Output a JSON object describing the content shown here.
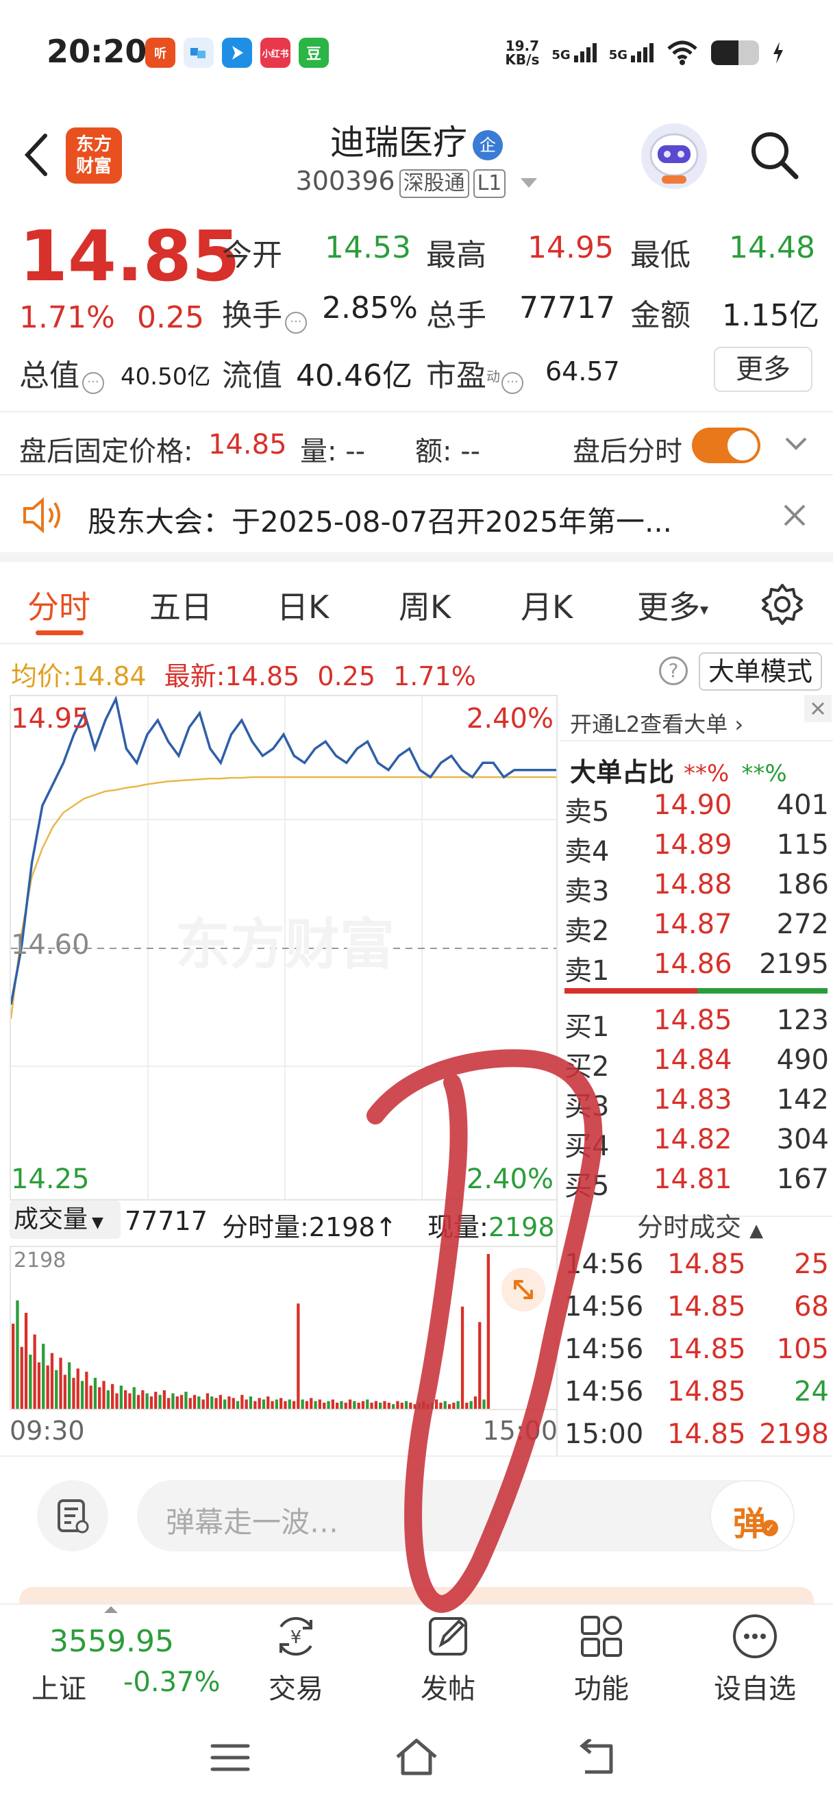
{
  "status_bar": {
    "time": "20:20",
    "app_icons": [
      "听",
      "",
      "",
      "小红书",
      "豆"
    ],
    "net_speed_top": "19.7",
    "net_speed_bottom": "KB/s",
    "sig1": "5G",
    "sig2": "5G"
  },
  "header": {
    "back_icon": "chevron-left-icon",
    "logo_text": "东方财富",
    "stock_name": "迪瑞医疗",
    "badge": "企",
    "code": "300396",
    "tag1": "深股通",
    "tag2": "L1"
  },
  "quote": {
    "price": "14.85",
    "change_pct": "1.71%",
    "change": "0.25",
    "fields": [
      {
        "label": "今开",
        "value": "14.53",
        "color": "green"
      },
      {
        "label": "最高",
        "value": "14.95",
        "color": "red"
      },
      {
        "label": "最低",
        "value": "14.48",
        "color": "green"
      },
      {
        "label": "换手",
        "value": "2.85%",
        "color": "dark"
      },
      {
        "label": "总手",
        "value": "77717",
        "color": "dark"
      },
      {
        "label": "金额",
        "value": "1.15亿",
        "color": "dark"
      },
      {
        "label": "总值",
        "value": "40.50亿",
        "color": "dark"
      },
      {
        "label": "流值",
        "value": "40.46亿",
        "color": "dark"
      },
      {
        "label": "市盈",
        "value": "64.57",
        "color": "dark"
      }
    ],
    "pe_sup": "动",
    "more_label": "更多"
  },
  "after_hours": {
    "label": "盘后固定价格:",
    "price": "14.85",
    "vol_label": "量:",
    "vol_value": "--",
    "amt_label": "额:",
    "amt_value": "--",
    "toggle_label": "盘后分时",
    "toggle_on": true
  },
  "notice": {
    "text": "股东大会：于2025-08-07召开2025年第一..."
  },
  "tabs": [
    "分时",
    "五日",
    "日K",
    "周K",
    "月K",
    "更多"
  ],
  "avg_line": {
    "avg_label": "均价:",
    "avg_value": "14.84",
    "latest_label": "最新:",
    "latest_value": "14.85",
    "change": "0.25",
    "pct": "1.71%",
    "mode_label": "大单模式"
  },
  "chart_data": {
    "type": "line",
    "title": "",
    "y_high_label": "14.95",
    "y_mid_label": "14.60",
    "y_low_label": "14.25",
    "pct_high_label": "2.40%",
    "pct_low_label": "2.40%",
    "ylim": [
      14.25,
      14.95
    ],
    "prev_close": 14.6,
    "price_series": [
      14.52,
      14.6,
      14.72,
      14.8,
      14.83,
      14.86,
      14.9,
      14.93,
      14.88,
      14.92,
      14.95,
      14.88,
      14.86,
      14.9,
      14.92,
      14.89,
      14.87,
      14.91,
      14.93,
      14.88,
      14.86,
      14.9,
      14.92,
      14.89,
      14.87,
      14.88,
      14.9,
      14.87,
      14.86,
      14.88,
      14.89,
      14.87,
      14.86,
      14.88,
      14.89,
      14.86,
      14.85,
      14.87,
      14.88,
      14.85,
      14.84,
      14.86,
      14.87,
      14.85,
      14.84,
      14.86,
      14.86,
      14.84,
      14.85,
      14.85,
      14.85,
      14.85,
      14.85
    ],
    "avg_series": [
      14.5,
      14.62,
      14.7,
      14.74,
      14.77,
      14.79,
      14.8,
      14.81,
      14.815,
      14.82,
      14.822,
      14.825,
      14.827,
      14.83,
      14.832,
      14.834,
      14.835,
      14.836,
      14.837,
      14.838,
      14.838,
      14.839,
      14.839,
      14.84,
      14.84,
      14.84,
      14.84,
      14.84,
      14.84,
      14.84,
      14.84,
      14.84,
      14.84,
      14.84,
      14.84,
      14.84,
      14.84,
      14.84,
      14.84,
      14.84,
      14.84,
      14.84,
      14.84,
      14.84,
      14.84,
      14.84,
      14.84,
      14.84,
      14.84,
      14.84,
      14.84,
      14.84,
      14.84
    ],
    "watermark": "东方财富"
  },
  "volume": {
    "label": "成交量",
    "total": "77717",
    "per_min": "分时量:2198↑",
    "cur_label": "现量:",
    "cur_value": "2198",
    "max_label": "2198",
    "time_start": "09:30",
    "time_end": "15:00",
    "bars": [
      0.55,
      0.7,
      0.4,
      0.62,
      0.35,
      0.48,
      0.3,
      0.42,
      0.28,
      0.36,
      0.25,
      0.33,
      0.22,
      0.3,
      0.2,
      0.26,
      0.18,
      0.24,
      0.15,
      0.2,
      0.14,
      0.18,
      0.12,
      0.16,
      0.1,
      0.15,
      0.12,
      0.1,
      0.14,
      0.09,
      0.12,
      0.1,
      0.08,
      0.11,
      0.09,
      0.12,
      0.07,
      0.1,
      0.08,
      0.09,
      0.11,
      0.07,
      0.09,
      0.08,
      0.06,
      0.1,
      0.08,
      0.07,
      0.09,
      0.06,
      0.08,
      0.07,
      0.05,
      0.09,
      0.06,
      0.08,
      0.05,
      0.07,
      0.06,
      0.08,
      0.05,
      0.06,
      0.07,
      0.05,
      0.06,
      0.05,
      0.68,
      0.06,
      0.05,
      0.07,
      0.05,
      0.06,
      0.04,
      0.05,
      0.06,
      0.04,
      0.05,
      0.04,
      0.06,
      0.05,
      0.04,
      0.05,
      0.06,
      0.04,
      0.05,
      0.04,
      0.05,
      0.04,
      0.03,
      0.05,
      0.04,
      0.05,
      0.04,
      0.03,
      0.04,
      0.05,
      0.03,
      0.04,
      0.06,
      0.04,
      0.05,
      0.03,
      0.04,
      0.05,
      0.66,
      0.04,
      0.05,
      0.08,
      0.56,
      0.06,
      1.0
    ]
  },
  "order_book": {
    "l2_link": "开通L2查看大单",
    "ratio_label": "大单占比",
    "ratio_a": "**%",
    "ratio_b": "**%",
    "asks": [
      {
        "label": "卖5",
        "price": "14.90",
        "vol": "401"
      },
      {
        "label": "卖4",
        "price": "14.89",
        "vol": "115"
      },
      {
        "label": "卖3",
        "price": "14.88",
        "vol": "186"
      },
      {
        "label": "卖2",
        "price": "14.87",
        "vol": "272"
      },
      {
        "label": "卖1",
        "price": "14.86",
        "vol": "2195"
      }
    ],
    "bids": [
      {
        "label": "买1",
        "price": "14.85",
        "vol": "123"
      },
      {
        "label": "买2",
        "price": "14.84",
        "vol": "490"
      },
      {
        "label": "买3",
        "price": "14.83",
        "vol": "142"
      },
      {
        "label": "买4",
        "price": "14.82",
        "vol": "304"
      },
      {
        "label": "买5",
        "price": "14.81",
        "vol": "167"
      }
    ],
    "trades_title": "分时成交",
    "trades": [
      {
        "time": "14:56",
        "price": "14.85",
        "vol": "25",
        "color": "red"
      },
      {
        "time": "14:56",
        "price": "14.85",
        "vol": "68",
        "color": "red"
      },
      {
        "time": "14:56",
        "price": "14.85",
        "vol": "105",
        "color": "red"
      },
      {
        "time": "14:56",
        "price": "14.85",
        "vol": "24",
        "color": "green"
      },
      {
        "time": "15:00",
        "price": "14.85",
        "vol": "2198",
        "color": "red"
      }
    ]
  },
  "danmu": {
    "placeholder": "弹幕走一波…",
    "send_label": "弹"
  },
  "bottom_nav": {
    "index_value": "3559.95",
    "index_name": "上证",
    "index_change": "-0.37%",
    "items": [
      {
        "label": "交易",
        "icon": "yen-cycle-icon"
      },
      {
        "label": "发帖",
        "icon": "edit-icon"
      },
      {
        "label": "功能",
        "icon": "grid-icon"
      },
      {
        "label": "设自选",
        "icon": "more-dots-icon"
      }
    ]
  },
  "colors": {
    "up": "#d8302a",
    "down": "#2a9d3a",
    "accent": "#e9501f",
    "price_line": "#2f5fa8",
    "avg_line": "#e7b84a",
    "annotation": "#c8323a"
  }
}
